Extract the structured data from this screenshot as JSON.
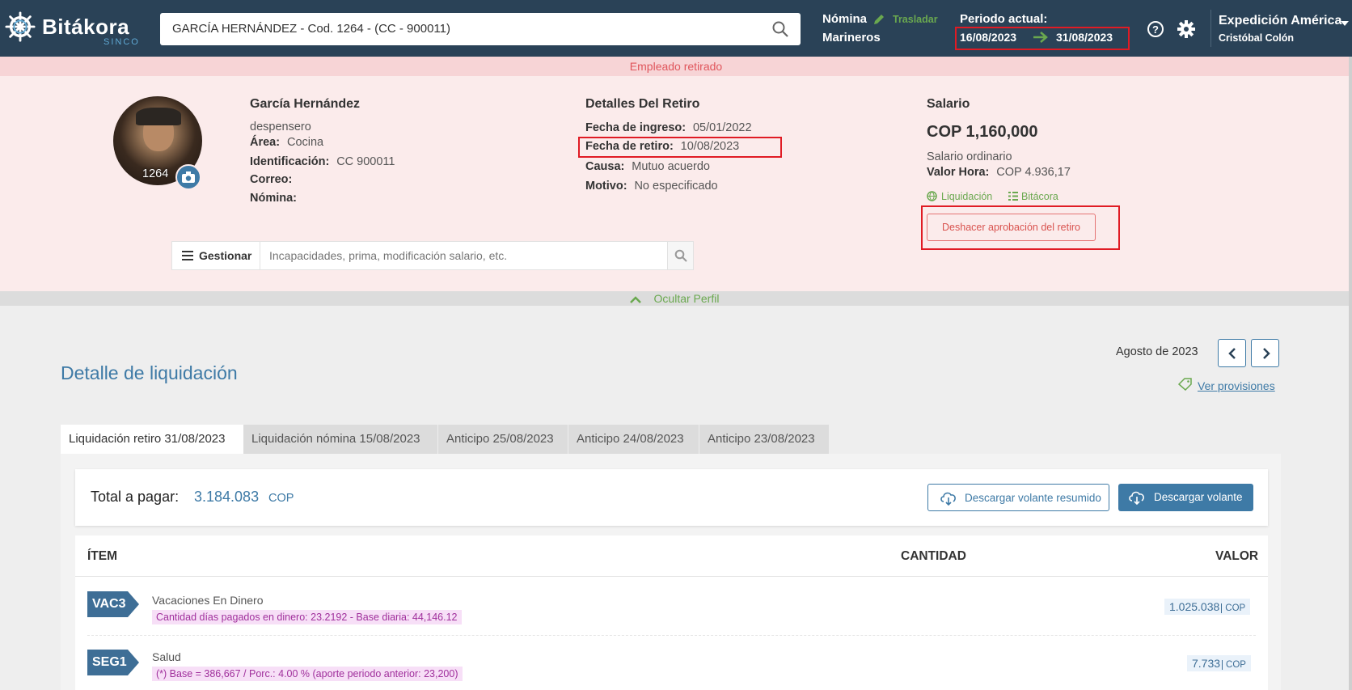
{
  "brand": {
    "name": "Bitákora",
    "sub": "SINCO"
  },
  "search": {
    "value": "GARCÍA HERNÁNDEZ - Cod. 1264 - (CC - 900011)"
  },
  "header": {
    "module_label": "Nómina",
    "transfer_label": "Trasladar",
    "payroll_name": "Marineros",
    "period_label": "Periodo actual:",
    "period_start": "16/08/2023",
    "period_end": "31/08/2023",
    "company": "Expedición América",
    "user": "Cristóbal Colón"
  },
  "status_banner": "Empleado retirado",
  "profile": {
    "name": "García Hernández",
    "role": "despensero",
    "code": "1264",
    "area_label": "Área:",
    "area": "Cocina",
    "id_label": "Identificación:",
    "id": "CC 900011",
    "email_label": "Correo:",
    "payroll_label": "Nómina:"
  },
  "retirement": {
    "title": "Detalles Del Retiro",
    "start_label": "Fecha de ingreso:",
    "start": "05/01/2022",
    "retire_label": "Fecha de retiro:",
    "retire": "10/08/2023",
    "cause_label": "Causa:",
    "cause": "Mutuo acuerdo",
    "reason_label": "Motivo:",
    "reason": "No especificado"
  },
  "salary": {
    "title": "Salario",
    "amount": "COP 1,160,000",
    "type": "Salario ordinario",
    "hour_label": "Valor Hora:",
    "hour_value": "COP 4.936,17",
    "link_liq": "Liquidación",
    "link_bit": "Bitácora",
    "undo_button": "Deshacer aprobación del retiro"
  },
  "manage": {
    "button": "Gestionar",
    "placeholder": "Incapacidades, prima, modificación salario, etc."
  },
  "hide_profile": "Ocultar Perfil",
  "section_title": "Detalle de liquidación",
  "month_nav": {
    "label": "Agosto de 2023"
  },
  "provisions_link": "Ver provisiones",
  "tabs": [
    "Liquidación retiro 31/08/2023",
    "Liquidación nómina 15/08/2023",
    "Anticipo 25/08/2023",
    "Anticipo 24/08/2023",
    "Anticipo 23/08/2023"
  ],
  "total": {
    "label": "Total a pagar:",
    "amount": "3.184.083",
    "currency": "COP",
    "btn_summary": "Descargar volante resumido",
    "btn_full": "Descargar volante"
  },
  "table": {
    "col_item": "ÍTEM",
    "col_qty": "CANTIDAD",
    "col_value": "VALOR",
    "rows": [
      {
        "code": "VAC3",
        "name": "Vacaciones En Dinero",
        "note": "Cantidad días pagados en dinero: 23.2192 - Base diaria: 44,146.12",
        "value": "1.025.038",
        "currency": "COP"
      },
      {
        "code": "SEG1",
        "name": "Salud",
        "note": "(*) Base = 386,667 / Porc.: 4.00 % (aporte periodo anterior: 23,200)",
        "value": "7.733",
        "currency": "COP"
      }
    ]
  },
  "colors": {
    "topbar": "#2a4257",
    "accent": "#3e7aa6",
    "danger": "#e01b24",
    "green": "#6aa84f"
  }
}
